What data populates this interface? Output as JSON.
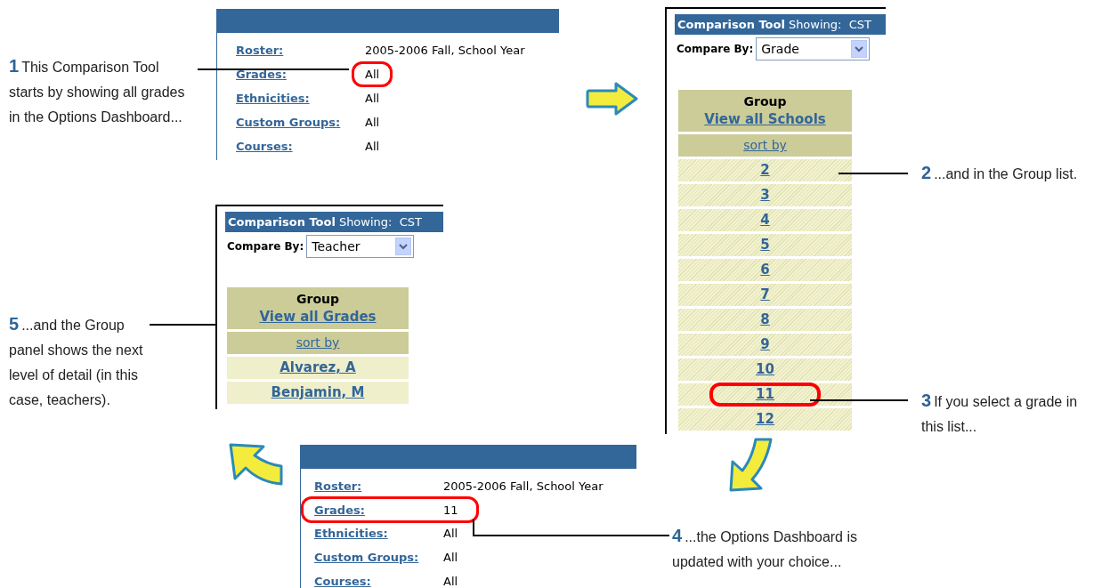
{
  "dashboards": [
    {
      "rows": [
        {
          "label": "Roster:",
          "value": "2005-2006 Fall, School Year",
          "value_circled": false,
          "row_circled": false
        },
        {
          "label": "Grades:",
          "value": "All",
          "value_circled": true,
          "row_circled": false
        },
        {
          "label": "Ethnicities:",
          "value": "All",
          "value_circled": false,
          "row_circled": false
        },
        {
          "label": "Custom Groups:",
          "value": "All",
          "value_circled": false,
          "row_circled": false
        },
        {
          "label": "Courses:",
          "value": "All",
          "value_circled": false,
          "row_circled": false
        }
      ]
    },
    {
      "rows": [
        {
          "label": "Roster:",
          "value": "2005-2006 Fall, School Year",
          "value_circled": false,
          "row_circled": false
        },
        {
          "label": "Grades:",
          "value": "11",
          "value_circled": false,
          "row_circled": true
        },
        {
          "label": "Ethnicities:",
          "value": "All",
          "value_circled": false,
          "row_circled": false
        },
        {
          "label": "Custom Groups:",
          "value": "All",
          "value_circled": false,
          "row_circled": false
        },
        {
          "label": "Courses:",
          "value": "All",
          "value_circled": false,
          "row_circled": false
        }
      ]
    }
  ],
  "panels": [
    {
      "title": "Comparison Tool",
      "showing": "Showing:  CST",
      "compare_label": "Compare By:",
      "compare_value": "Grade",
      "group_heading": "Group",
      "view_all": "View all Schools",
      "sort": "sort by",
      "patterned": true,
      "items": [
        {
          "label": "2",
          "circled": false
        },
        {
          "label": "3",
          "circled": false
        },
        {
          "label": "4",
          "circled": false
        },
        {
          "label": "5",
          "circled": false
        },
        {
          "label": "6",
          "circled": false
        },
        {
          "label": "7",
          "circled": false
        },
        {
          "label": "8",
          "circled": false
        },
        {
          "label": "9",
          "circled": false
        },
        {
          "label": "10",
          "circled": false
        },
        {
          "label": "11",
          "circled": true
        },
        {
          "label": "12",
          "circled": false
        }
      ]
    },
    {
      "title": "Comparison Tool",
      "showing": "Showing:  CST",
      "compare_label": "Compare By:",
      "compare_value": "Teacher",
      "group_heading": "Group",
      "view_all": "View all Grades",
      "sort": "sort by",
      "patterned": false,
      "items": [
        {
          "label": "Alvarez, A",
          "circled": false
        },
        {
          "label": "Benjamin, M",
          "circled": false
        }
      ]
    }
  ],
  "callouts": [
    {
      "number": "1",
      "text": "This Comparison Tool starts by showing all grades in the Options Dashboard..."
    },
    {
      "number": "2",
      "text": "...and in the Group list."
    },
    {
      "number": "3",
      "text": "If you select a grade in this list..."
    },
    {
      "number": "4",
      "text": "...the Options Dashboard is updated with your choice..."
    },
    {
      "number": "5",
      "text": "...and the Group panel shows the next level of detail (in this case, teachers)."
    }
  ]
}
